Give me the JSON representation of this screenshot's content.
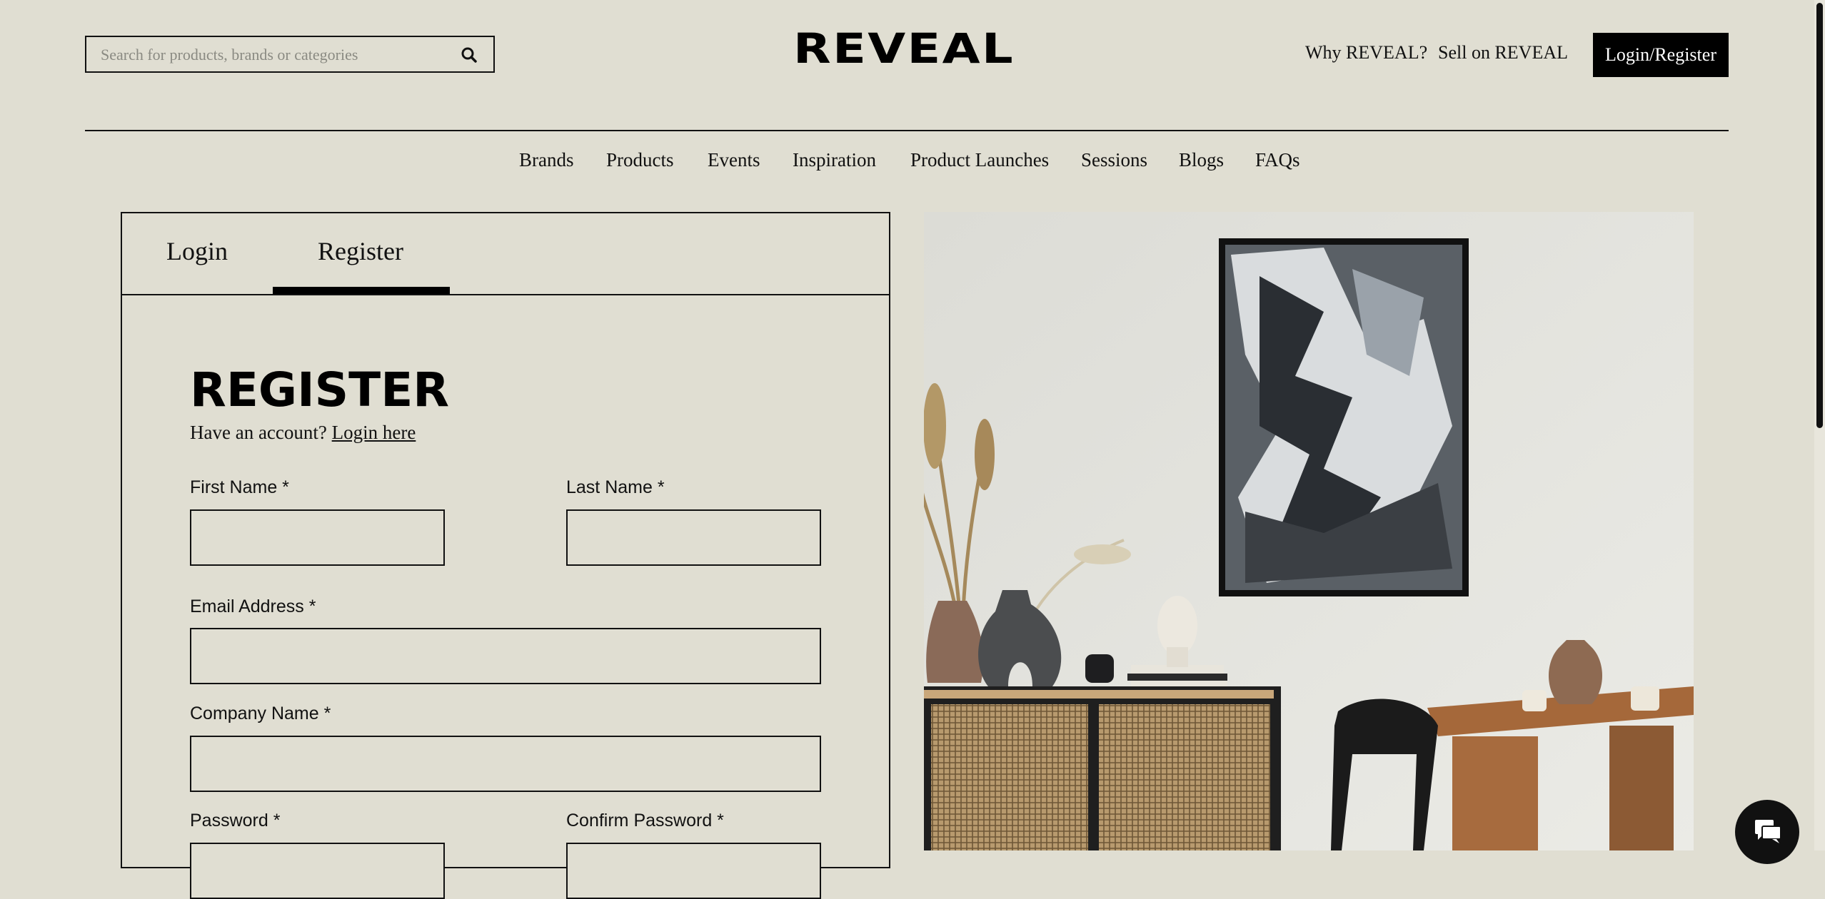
{
  "header": {
    "search_placeholder": "Search for products, brands or categories",
    "logo": "REVEAL",
    "links": [
      "Why REVEAL?",
      "Sell on REVEAL"
    ],
    "login_register": "Login/Register"
  },
  "nav": [
    "Brands",
    "Products",
    "Events",
    "Inspiration",
    "Product Launches",
    "Sessions",
    "Blogs",
    "FAQs"
  ],
  "tabs": {
    "login": "Login",
    "register": "Register",
    "active": "Register"
  },
  "form": {
    "title": "REGISTER",
    "have_account": "Have an account?",
    "login_here": "Login here",
    "first_name_label": "First Name *",
    "last_name_label": "Last Name *",
    "email_label": "Email Address *",
    "company_label": "Company Name *",
    "password_label": "Password *",
    "confirm_password_label": "Confirm Password *"
  },
  "colors": {
    "background": "#e0ded2",
    "ink": "#111111",
    "button": "#000000"
  },
  "icons": {
    "search": "search-icon",
    "chat": "chat-icon"
  }
}
